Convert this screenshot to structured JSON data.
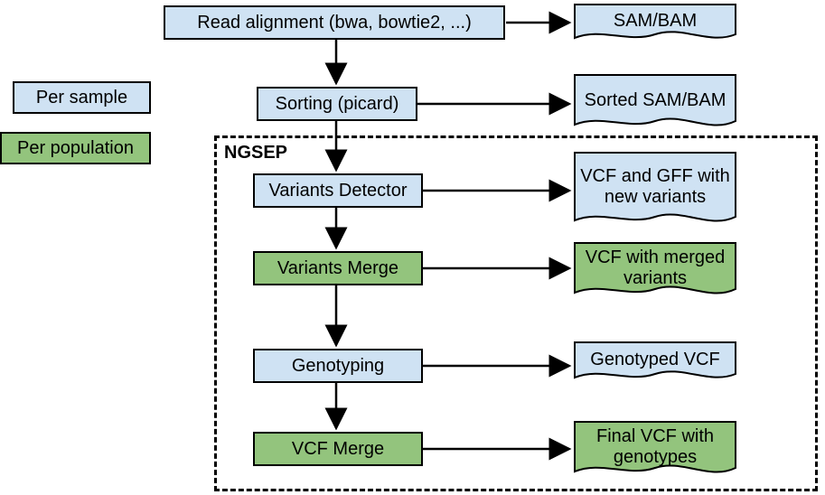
{
  "legend": {
    "per_sample": "Per sample",
    "per_population": "Per population"
  },
  "steps": {
    "read_alignment": "Read alignment (bwa, bowtie2, ...)",
    "sorting": "Sorting (picard)",
    "variants_detector": "Variants Detector",
    "variants_merge": "Variants Merge",
    "genotyping": "Genotyping",
    "vcf_merge": "VCF Merge"
  },
  "outputs": {
    "sam_bam": "SAM/BAM",
    "sorted_sam_bam": "Sorted SAM/BAM",
    "vcf_gff_new": "VCF and GFF with new variants",
    "vcf_merged": "VCF with merged variants",
    "genotyped_vcf": "Genotyped VCF",
    "final_vcf": "Final VCF with genotypes"
  },
  "group_label": "NGSEP",
  "colors": {
    "blue": "#cfe2f3",
    "green": "#93c47d"
  }
}
